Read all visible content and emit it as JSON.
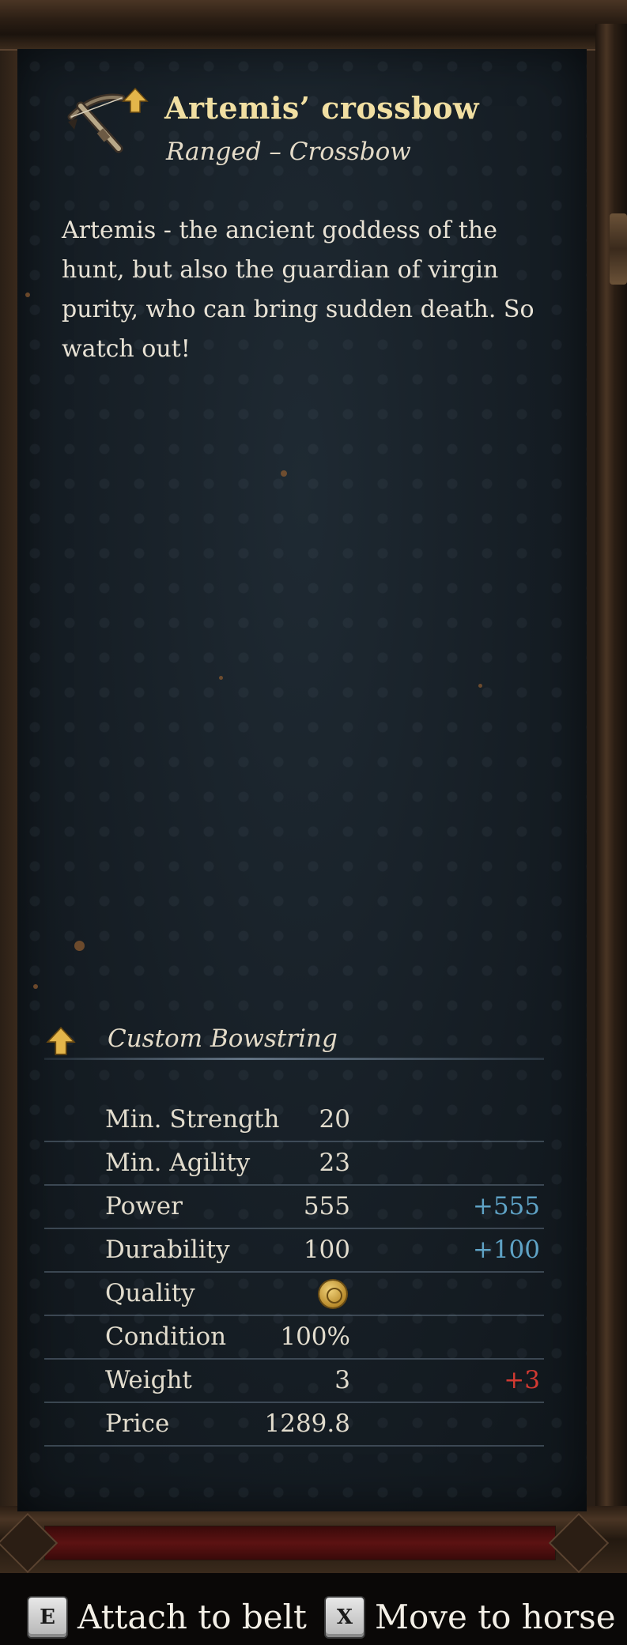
{
  "item": {
    "name": "Artemis’ crossbow",
    "type": "Ranged – Crossbow",
    "description": "Artemis - the ancient goddess of the hunt, but also the guardian of virgin purity, who can bring sudden death. So watch out!",
    "icon": "crossbow-icon",
    "upgrade_icon": "upgrade-arrow-icon"
  },
  "modification": {
    "label": "Custom Bowstring",
    "icon": "upgrade-arrow-icon"
  },
  "stats": [
    {
      "label": "Min. Strength",
      "value": "20",
      "delta": ""
    },
    {
      "label": "Min. Agility",
      "value": "23",
      "delta": ""
    },
    {
      "label": "Power",
      "value": "555",
      "delta": "+555"
    },
    {
      "label": "Durability",
      "value": "100",
      "delta": "+100"
    },
    {
      "label": "Quality",
      "value": "",
      "delta": "",
      "icon": "quality-coin-icon"
    },
    {
      "label": "Condition",
      "value": "100%",
      "delta": ""
    },
    {
      "label": "Weight",
      "value": "3",
      "delta": "+3"
    },
    {
      "label": "Price",
      "value": "1289.8",
      "delta": ""
    }
  ],
  "colors": {
    "title": "#f1dfa2",
    "positive_delta": "#5fa3c6",
    "negative_delta": "#d23a32",
    "text": "#e2dccd"
  },
  "actions": [
    {
      "key": "E",
      "label": "Attach to belt"
    },
    {
      "key": "X",
      "label": "Move to horse"
    }
  ]
}
